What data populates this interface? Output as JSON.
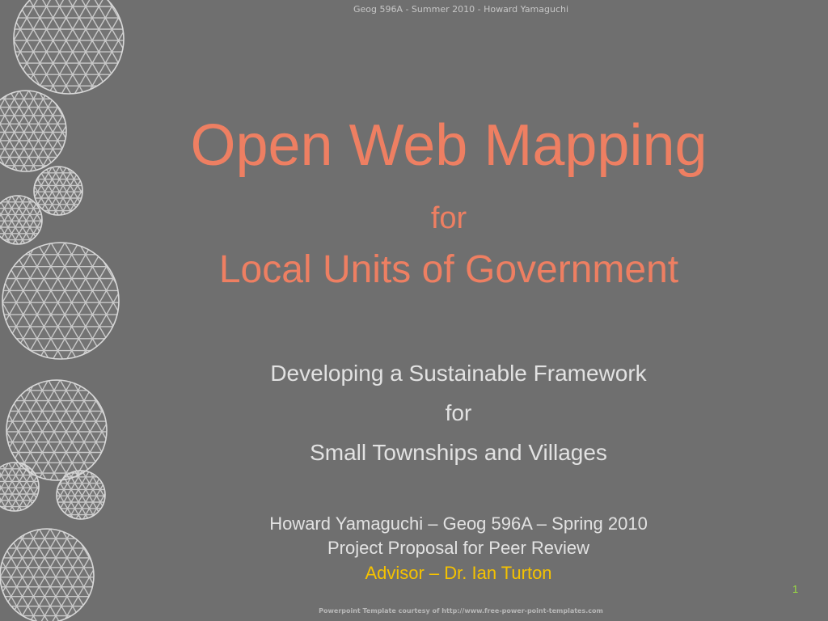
{
  "header": {
    "text": "Geog 596A - Summer 2010 - Howard Yamaguchi"
  },
  "title": {
    "main": "Open Web Mapping",
    "for": "for",
    "sub": "Local Units of Government"
  },
  "subtitle": {
    "line1": "Developing a Sustainable Framework",
    "line2": "for",
    "line3": "Small Townships and Villages"
  },
  "author": {
    "line1": "Howard Yamaguchi – Geog 596A – Spring 2010",
    "line2": "Project Proposal for Peer Review",
    "line3": "Advisor – Dr. Ian Turton"
  },
  "page_number": "1",
  "footer": {
    "text": "Powerpoint Template courtesy of http://www.free-power-point-templates.com"
  },
  "decoration": {
    "icon": "geodesic-sphere-icon",
    "stroke_color": "#d8d8d8"
  },
  "colors": {
    "background": "#6f6f6f",
    "title": "#ee7f62",
    "body_text": "#e2e2e2",
    "advisor": "#f5c200",
    "page_number": "#9be040"
  }
}
